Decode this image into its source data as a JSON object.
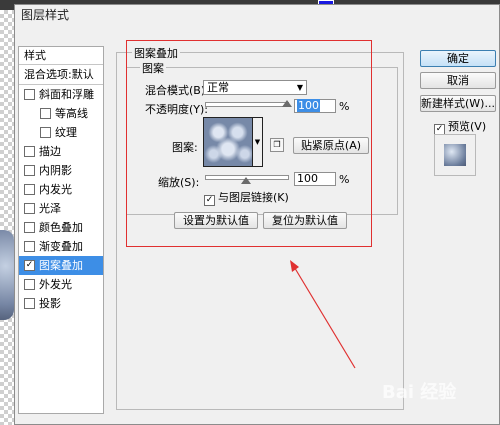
{
  "dialog": {
    "title": "图层样式"
  },
  "styles_list": {
    "header": "样式",
    "blending_options": "混合选项:默认",
    "items": [
      {
        "label": "斜面和浮雕",
        "checked": false,
        "sub": false,
        "selected": false
      },
      {
        "label": "等高线",
        "checked": false,
        "sub": true,
        "selected": false
      },
      {
        "label": "纹理",
        "checked": false,
        "sub": true,
        "selected": false
      },
      {
        "label": "描边",
        "checked": false,
        "sub": false,
        "selected": false
      },
      {
        "label": "内阴影",
        "checked": false,
        "sub": false,
        "selected": false
      },
      {
        "label": "内发光",
        "checked": false,
        "sub": false,
        "selected": false
      },
      {
        "label": "光泽",
        "checked": false,
        "sub": false,
        "selected": false
      },
      {
        "label": "颜色叠加",
        "checked": false,
        "sub": false,
        "selected": false
      },
      {
        "label": "渐变叠加",
        "checked": false,
        "sub": false,
        "selected": false
      },
      {
        "label": "图案叠加",
        "checked": true,
        "sub": false,
        "selected": true
      },
      {
        "label": "外发光",
        "checked": false,
        "sub": false,
        "selected": false
      },
      {
        "label": "投影",
        "checked": false,
        "sub": false,
        "selected": false
      }
    ]
  },
  "pattern_overlay": {
    "group_title": "图案叠加",
    "subgroup_title": "图案",
    "blend_mode_label": "混合模式(B):",
    "blend_mode_value": "正常",
    "opacity_label": "不透明度(Y):",
    "opacity_value": "100",
    "opacity_unit": "%",
    "opacity_level": 1.0,
    "pattern_label": "图案:",
    "snap_origin_button": "贴紧原点(A)",
    "scale_label": "缩放(S):",
    "scale_value": "100",
    "scale_unit": "%",
    "scale_level": 0.5,
    "link_with_layer_label": "与图层链接(K)",
    "link_with_layer_checked": true,
    "make_default_button": "设置为默认值",
    "reset_default_button": "复位为默认值"
  },
  "actions": {
    "ok": "确定",
    "cancel": "取消",
    "new_style": "新建样式(W)...",
    "preview_label": "预览(V)",
    "preview_checked": true
  },
  "watermark": "Bai 经验",
  "colors": {
    "selection": "#3d8ee6",
    "annotation": "#e03030"
  }
}
